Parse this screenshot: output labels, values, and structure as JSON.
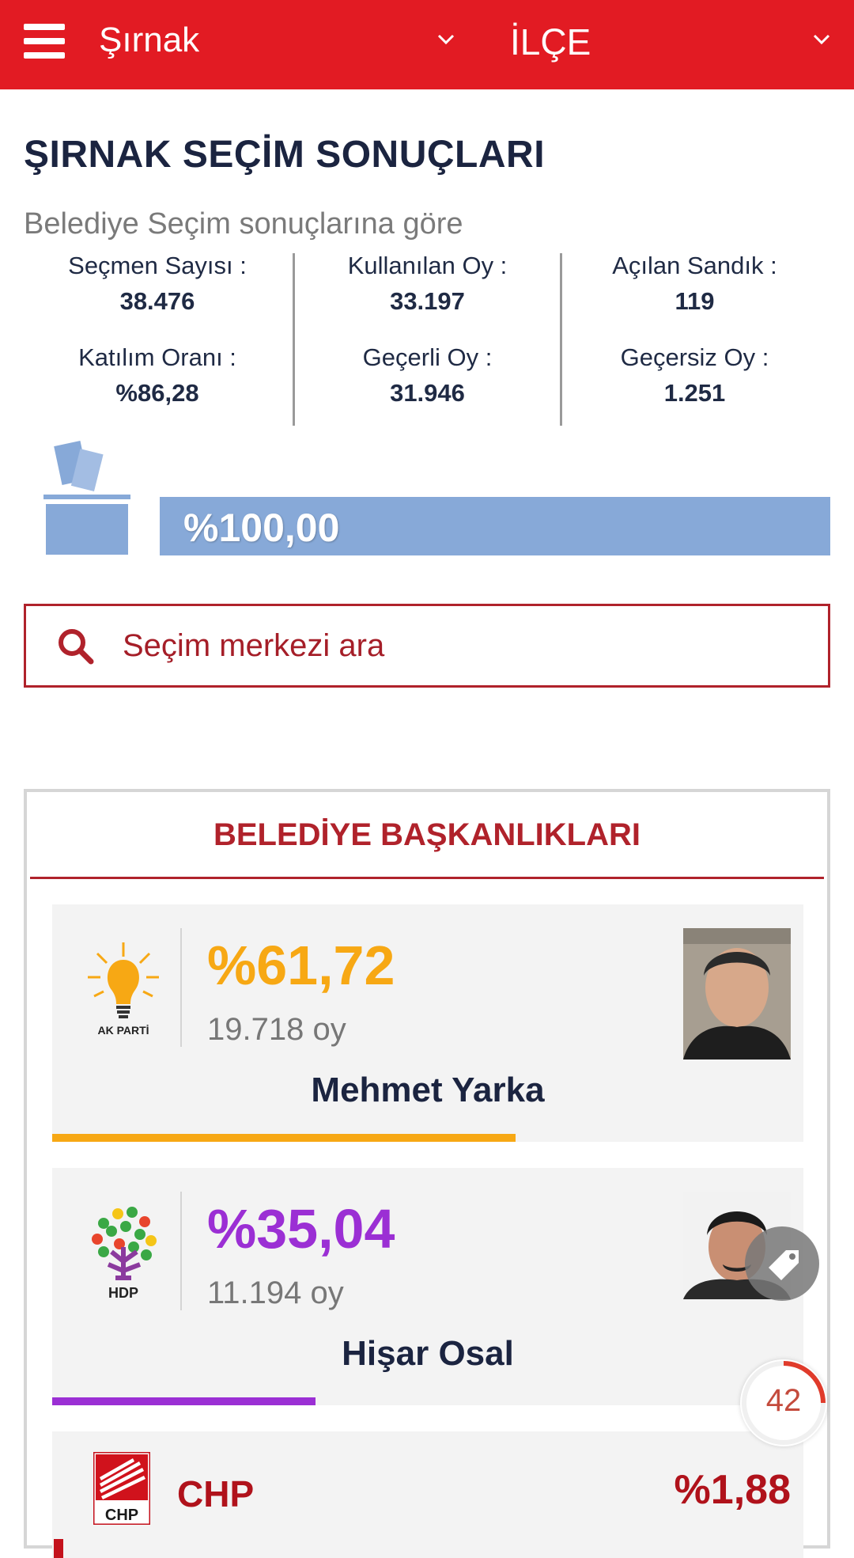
{
  "header": {
    "city": "Şırnak",
    "district": "İLÇE"
  },
  "page": {
    "title": "ŞIRNAK SEÇİM SONUÇLARI",
    "subtitle": "Belediye Seçim sonuçlarına göre"
  },
  "stats": [
    {
      "label": "Seçmen Sayısı :",
      "value": "38.476"
    },
    {
      "label": "Kullanılan Oy :",
      "value": "33.197"
    },
    {
      "label": "Açılan Sandık :",
      "value": "119"
    },
    {
      "label": "Katılım Oranı :",
      "value": "%86,28"
    },
    {
      "label": "Geçerli Oy :",
      "value": "31.946"
    },
    {
      "label": "Geçersiz Oy :",
      "value": "1.251"
    }
  ],
  "progress": {
    "label": "%100,00",
    "fraction": 1.0
  },
  "search": {
    "placeholder": "Seçim merkezi ara"
  },
  "results": {
    "title": "BELEDİYE BAŞKANLIKLARI",
    "candidates": [
      {
        "party": "AK PARTİ",
        "percent": "%61,72",
        "votes": "19.718 oy",
        "name": "Mehmet Yarka",
        "color": "#f7a814",
        "share": 0.6172
      },
      {
        "party": "HDP",
        "percent": "%35,04",
        "votes": "11.194 oy",
        "name": "Hişar Osal",
        "color": "#9b2fd4",
        "share": 0.3504
      }
    ],
    "other": {
      "party": "CHP",
      "percent": "%1,88",
      "color": "#b0121b"
    }
  },
  "overlay": {
    "counter": "42"
  }
}
